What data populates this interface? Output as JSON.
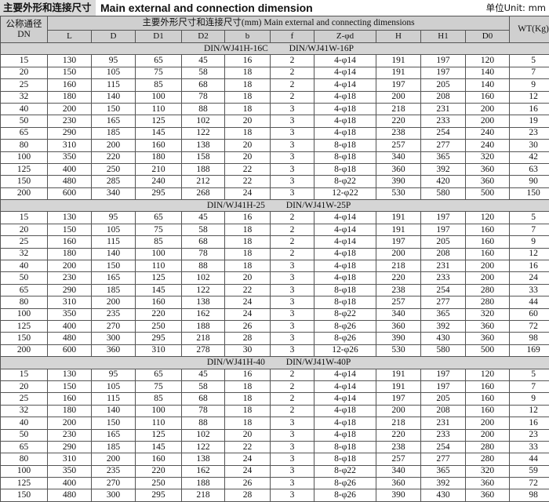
{
  "header": {
    "title_cn": "主要外形和连接尺寸",
    "title_en": "Main external and connection dimension",
    "unit": "单位Unit: mm"
  },
  "table": {
    "dn_header_line1": "公称通径",
    "dn_header_line2": "DN",
    "dims_header": "主要外形尺寸和连接尺寸(mm) Main external and connecting dimensions",
    "wt_header": "WT(Kg)",
    "columns": [
      "L",
      "D",
      "D1",
      "D2",
      "b",
      "f",
      "Z-φd",
      "H",
      "H1",
      "D0"
    ],
    "groups": [
      {
        "label": "DIN/WJ41H-16C DIN/WJ41W-16P",
        "rows": [
          [
            "15",
            "130",
            "95",
            "65",
            "45",
            "16",
            "2",
            "4-φ14",
            "191",
            "197",
            "120",
            "5"
          ],
          [
            "20",
            "150",
            "105",
            "75",
            "58",
            "18",
            "2",
            "4-φ14",
            "191",
            "197",
            "140",
            "7"
          ],
          [
            "25",
            "160",
            "115",
            "85",
            "68",
            "18",
            "2",
            "4-φ14",
            "197",
            "205",
            "140",
            "9"
          ],
          [
            "32",
            "180",
            "140",
            "100",
            "78",
            "18",
            "2",
            "4-φ18",
            "200",
            "208",
            "160",
            "12"
          ],
          [
            "40",
            "200",
            "150",
            "110",
            "88",
            "18",
            "3",
            "4-φ18",
            "218",
            "231",
            "200",
            "16"
          ],
          [
            "50",
            "230",
            "165",
            "125",
            "102",
            "20",
            "3",
            "4-φ18",
            "220",
            "233",
            "200",
            "19"
          ],
          [
            "65",
            "290",
            "185",
            "145",
            "122",
            "18",
            "3",
            "4-φ18",
            "238",
            "254",
            "240",
            "23"
          ],
          [
            "80",
            "310",
            "200",
            "160",
            "138",
            "20",
            "3",
            "8-φ18",
            "257",
            "277",
            "240",
            "30"
          ],
          [
            "100",
            "350",
            "220",
            "180",
            "158",
            "20",
            "3",
            "8-φ18",
            "340",
            "365",
            "320",
            "42"
          ],
          [
            "125",
            "400",
            "250",
            "210",
            "188",
            "22",
            "3",
            "8-φ18",
            "360",
            "392",
            "360",
            "63"
          ],
          [
            "150",
            "480",
            "285",
            "240",
            "212",
            "22",
            "3",
            "8-φ22",
            "390",
            "420",
            "360",
            "90"
          ],
          [
            "200",
            "600",
            "340",
            "295",
            "268",
            "24",
            "3",
            "12-φ22",
            "530",
            "580",
            "500",
            "150"
          ]
        ]
      },
      {
        "label": "DIN/WJ41H-25 DIN/WJ41W-25P",
        "rows": [
          [
            "15",
            "130",
            "95",
            "65",
            "45",
            "16",
            "2",
            "4-φ14",
            "191",
            "197",
            "120",
            "5"
          ],
          [
            "20",
            "150",
            "105",
            "75",
            "58",
            "18",
            "2",
            "4-φ14",
            "191",
            "197",
            "160",
            "7"
          ],
          [
            "25",
            "160",
            "115",
            "85",
            "68",
            "18",
            "2",
            "4-φ14",
            "197",
            "205",
            "160",
            "9"
          ],
          [
            "32",
            "180",
            "140",
            "100",
            "78",
            "18",
            "2",
            "4-φ18",
            "200",
            "208",
            "160",
            "12"
          ],
          [
            "40",
            "200",
            "150",
            "110",
            "88",
            "18",
            "3",
            "4-φ18",
            "218",
            "231",
            "200",
            "16"
          ],
          [
            "50",
            "230",
            "165",
            "125",
            "102",
            "20",
            "3",
            "4-φ18",
            "220",
            "233",
            "200",
            "24"
          ],
          [
            "65",
            "290",
            "185",
            "145",
            "122",
            "22",
            "3",
            "8-φ18",
            "238",
            "254",
            "280",
            "33"
          ],
          [
            "80",
            "310",
            "200",
            "160",
            "138",
            "24",
            "3",
            "8-φ18",
            "257",
            "277",
            "280",
            "44"
          ],
          [
            "100",
            "350",
            "235",
            "220",
            "162",
            "24",
            "3",
            "8-φ22",
            "340",
            "365",
            "320",
            "60"
          ],
          [
            "125",
            "400",
            "270",
            "250",
            "188",
            "26",
            "3",
            "8-φ26",
            "360",
            "392",
            "360",
            "72"
          ],
          [
            "150",
            "480",
            "300",
            "295",
            "218",
            "28",
            "3",
            "8-φ26",
            "390",
            "430",
            "360",
            "98"
          ],
          [
            "200",
            "600",
            "360",
            "310",
            "278",
            "30",
            "3",
            "12-φ26",
            "530",
            "580",
            "500",
            "169"
          ]
        ]
      },
      {
        "label": "DIN/WJ41H-40 DIN/WJ41W-40P",
        "rows": [
          [
            "15",
            "130",
            "95",
            "65",
            "45",
            "16",
            "2",
            "4-φ14",
            "191",
            "197",
            "120",
            "5"
          ],
          [
            "20",
            "150",
            "105",
            "75",
            "58",
            "18",
            "2",
            "4-φ14",
            "191",
            "197",
            "160",
            "7"
          ],
          [
            "25",
            "160",
            "115",
            "85",
            "68",
            "18",
            "2",
            "4-φ14",
            "197",
            "205",
            "160",
            "9"
          ],
          [
            "32",
            "180",
            "140",
            "100",
            "78",
            "18",
            "2",
            "4-φ18",
            "200",
            "208",
            "160",
            "12"
          ],
          [
            "40",
            "200",
            "150",
            "110",
            "88",
            "18",
            "3",
            "4-φ18",
            "218",
            "231",
            "200",
            "16"
          ],
          [
            "50",
            "230",
            "165",
            "125",
            "102",
            "20",
            "3",
            "4-φ18",
            "220",
            "233",
            "200",
            "23"
          ],
          [
            "65",
            "290",
            "185",
            "145",
            "122",
            "22",
            "3",
            "8-φ18",
            "238",
            "254",
            "280",
            "33"
          ],
          [
            "80",
            "310",
            "200",
            "160",
            "138",
            "24",
            "3",
            "8-φ18",
            "257",
            "277",
            "280",
            "44"
          ],
          [
            "100",
            "350",
            "235",
            "220",
            "162",
            "24",
            "3",
            "8-φ22",
            "340",
            "365",
            "320",
            "59"
          ],
          [
            "125",
            "400",
            "270",
            "250",
            "188",
            "26",
            "3",
            "8-φ26",
            "360",
            "392",
            "360",
            "72"
          ],
          [
            "150",
            "480",
            "300",
            "295",
            "218",
            "28",
            "3",
            "8-φ26",
            "390",
            "430",
            "360",
            "98"
          ]
        ]
      }
    ]
  }
}
